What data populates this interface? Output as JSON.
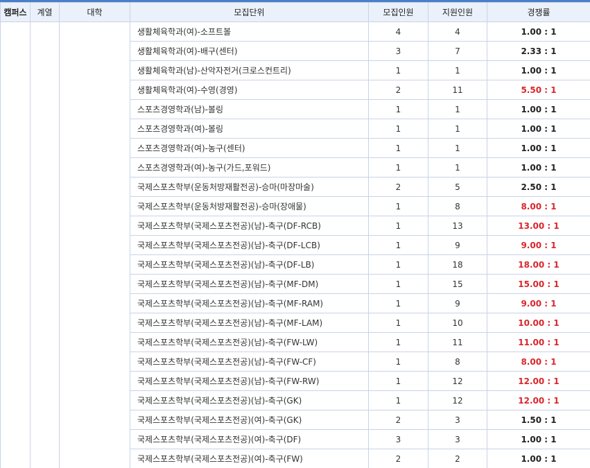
{
  "header": {
    "campus": "캠퍼스",
    "division": "계열",
    "college": "대학",
    "unit": "모집단위",
    "quota": "모집인원",
    "applicants": "지원인원",
    "ratio": "경쟁률"
  },
  "colors": {
    "header_bg": "#eaf1fa",
    "border": "#c8d3e6",
    "accent_line": "#4a7ec6",
    "high_ratio": "#d9262c"
  },
  "rows": [
    {
      "unit": "생활체육학과(여)-소프트볼",
      "quota": "4",
      "applicants": "4",
      "ratio": "1.00 : 1",
      "high": false
    },
    {
      "unit": "생활체육학과(여)-배구(센터)",
      "quota": "3",
      "applicants": "7",
      "ratio": "2.33 : 1",
      "high": false
    },
    {
      "unit": "생활체육학과(남)-산악자전거(크로스컨트리)",
      "quota": "1",
      "applicants": "1",
      "ratio": "1.00 : 1",
      "high": false
    },
    {
      "unit": "생활체육학과(여)-수영(경영)",
      "quota": "2",
      "applicants": "11",
      "ratio": "5.50 : 1",
      "high": true
    },
    {
      "unit": "스포츠경영학과(남)-볼링",
      "quota": "1",
      "applicants": "1",
      "ratio": "1.00 : 1",
      "high": false
    },
    {
      "unit": "스포츠경영학과(여)-볼링",
      "quota": "1",
      "applicants": "1",
      "ratio": "1.00 : 1",
      "high": false
    },
    {
      "unit": "스포츠경영학과(여)-농구(센터)",
      "quota": "1",
      "applicants": "1",
      "ratio": "1.00 : 1",
      "high": false
    },
    {
      "unit": "스포츠경영학과(여)-농구(가드,포워드)",
      "quota": "1",
      "applicants": "1",
      "ratio": "1.00 : 1",
      "high": false
    },
    {
      "unit": "국제스포츠학부(운동처방재활전공)-승마(마장마술)",
      "quota": "2",
      "applicants": "5",
      "ratio": "2.50 : 1",
      "high": false
    },
    {
      "unit": "국제스포츠학부(운동처방재활전공)-승마(장애물)",
      "quota": "1",
      "applicants": "8",
      "ratio": "8.00 : 1",
      "high": true
    },
    {
      "unit": "국제스포츠학부(국제스포츠전공)(남)-축구(DF-RCB)",
      "quota": "1",
      "applicants": "13",
      "ratio": "13.00 : 1",
      "high": true
    },
    {
      "unit": "국제스포츠학부(국제스포츠전공)(남)-축구(DF-LCB)",
      "quota": "1",
      "applicants": "9",
      "ratio": "9.00 : 1",
      "high": true
    },
    {
      "unit": "국제스포츠학부(국제스포츠전공)(남)-축구(DF-LB)",
      "quota": "1",
      "applicants": "18",
      "ratio": "18.00 : 1",
      "high": true
    },
    {
      "unit": "국제스포츠학부(국제스포츠전공)(남)-축구(MF-DM)",
      "quota": "1",
      "applicants": "15",
      "ratio": "15.00 : 1",
      "high": true
    },
    {
      "unit": "국제스포츠학부(국제스포츠전공)(남)-축구(MF-RAM)",
      "quota": "1",
      "applicants": "9",
      "ratio": "9.00 : 1",
      "high": true
    },
    {
      "unit": "국제스포츠학부(국제스포츠전공)(남)-축구(MF-LAM)",
      "quota": "1",
      "applicants": "10",
      "ratio": "10.00 : 1",
      "high": true
    },
    {
      "unit": "국제스포츠학부(국제스포츠전공)(남)-축구(FW-LW)",
      "quota": "1",
      "applicants": "11",
      "ratio": "11.00 : 1",
      "high": true
    },
    {
      "unit": "국제스포츠학부(국제스포츠전공)(남)-축구(FW-CF)",
      "quota": "1",
      "applicants": "8",
      "ratio": "8.00 : 1",
      "high": true
    },
    {
      "unit": "국제스포츠학부(국제스포츠전공)(남)-축구(FW-RW)",
      "quota": "1",
      "applicants": "12",
      "ratio": "12.00 : 1",
      "high": true
    },
    {
      "unit": "국제스포츠학부(국제스포츠전공)(남)-축구(GK)",
      "quota": "1",
      "applicants": "12",
      "ratio": "12.00 : 1",
      "high": true
    },
    {
      "unit": "국제스포츠학부(국제스포츠전공)(여)-축구(GK)",
      "quota": "2",
      "applicants": "3",
      "ratio": "1.50 : 1",
      "high": false
    },
    {
      "unit": "국제스포츠학부(국제스포츠전공)(여)-축구(DF)",
      "quota": "3",
      "applicants": "3",
      "ratio": "1.00 : 1",
      "high": false
    },
    {
      "unit": "국제스포츠학부(국제스포츠전공)(여)-축구(FW)",
      "quota": "2",
      "applicants": "2",
      "ratio": "1.00 : 1",
      "high": false
    }
  ]
}
